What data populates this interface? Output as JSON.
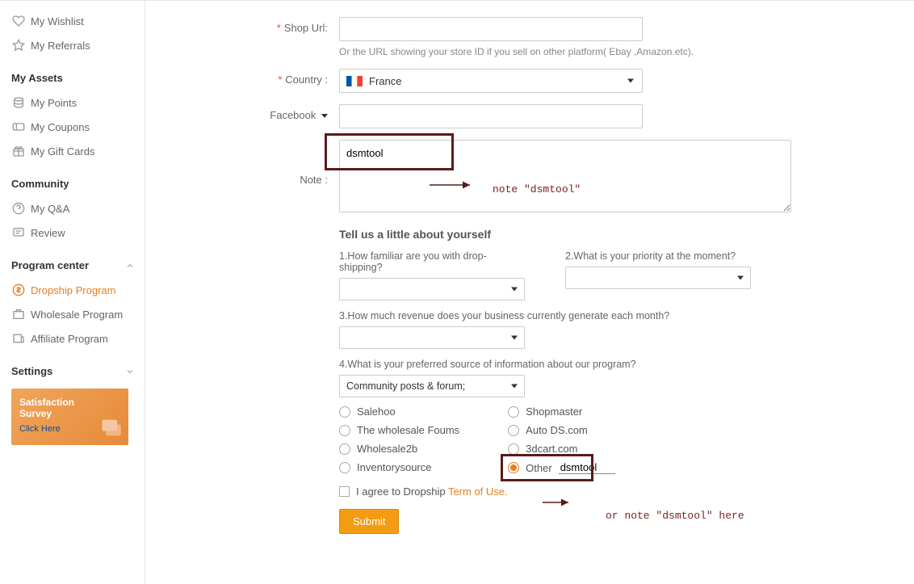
{
  "sidebar": {
    "top": [
      {
        "icon": "heart",
        "label": "My Wishlist"
      },
      {
        "icon": "star",
        "label": "My Referrals"
      }
    ],
    "assets_title": "My Assets",
    "assets": [
      {
        "icon": "coins",
        "label": "My Points"
      },
      {
        "icon": "coupon",
        "label": "My Coupons"
      },
      {
        "icon": "gift",
        "label": "My Gift Cards"
      }
    ],
    "community_title": "Community",
    "community": [
      {
        "icon": "question",
        "label": "My Q&A"
      },
      {
        "icon": "review",
        "label": "Review"
      }
    ],
    "program_title": "Program center",
    "program": [
      {
        "icon": "dollar",
        "label": "Dropship Program",
        "active": true
      },
      {
        "icon": "wholesale",
        "label": "Wholesale Program"
      },
      {
        "icon": "affiliate",
        "label": "Affiliate Program"
      }
    ],
    "settings_title": "Settings",
    "survey": {
      "l1": "Satisfaction",
      "l2": "Survey",
      "click": "Click Here"
    }
  },
  "form": {
    "shop_label": "Shop Url:",
    "shop_help": "Or the URL showing your store ID if you sell on other platform( Ebay ,Amazon.etc).",
    "country_label": "Country :",
    "country_value": "France",
    "facebook_label": "Facebook",
    "note_label": "Note :",
    "note_value": "dsmtool",
    "about_heading": "Tell us a little about yourself",
    "q1": "1.How familiar are you with drop-shipping?",
    "q2": "2.What is your priority at the moment?",
    "q3": "3.How much revenue does your business currently generate each month?",
    "q4": "4.What is your preferred source of information about our program?",
    "q4_selected": "Community posts & forum;",
    "radios_left": [
      "Salehoo",
      "The wholesale Foums",
      "Wholesale2b",
      "Inventorysource"
    ],
    "radios_right": [
      "Shopmaster",
      "Auto DS.com",
      "3dcart.com"
    ],
    "radio_other": "Other",
    "other_value": "dsmtool",
    "agree_pre": "I agree to Dropship ",
    "agree_link": "Term of Use.",
    "submit": "Submit"
  },
  "annotations": {
    "note": "note \"dsmtool\"",
    "other": "or  note \"dsmtool\" here"
  }
}
